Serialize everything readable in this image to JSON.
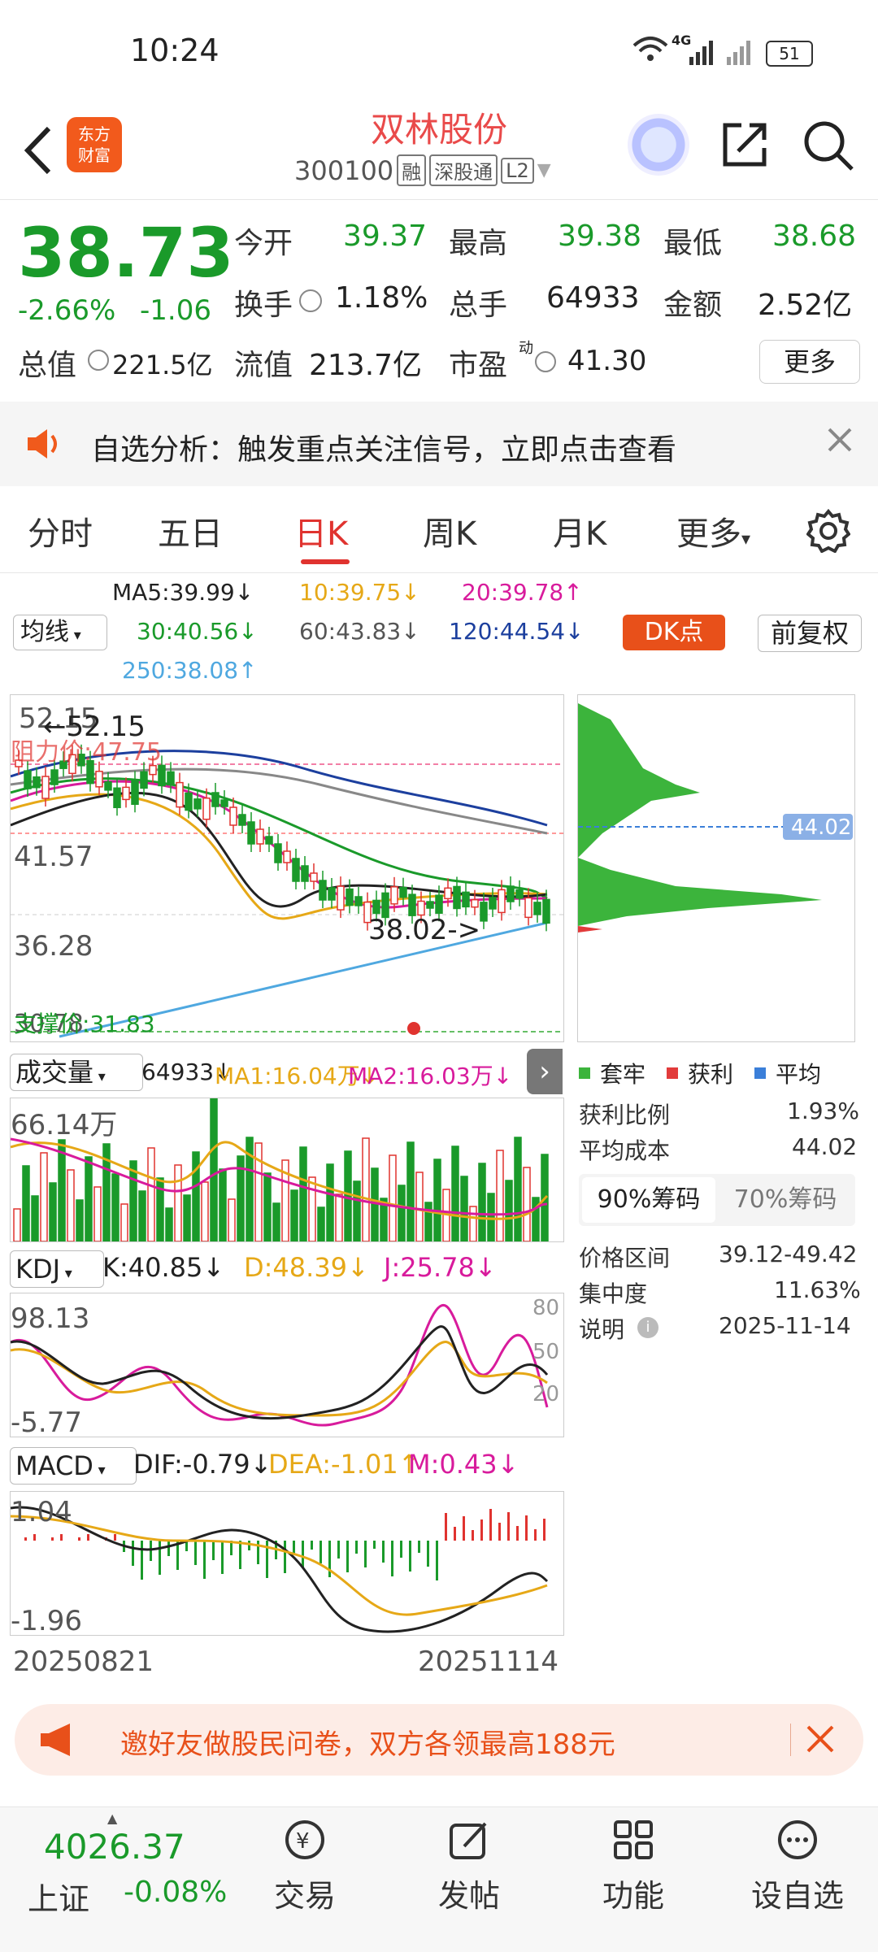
{
  "status": {
    "time": "10:24",
    "network": "4G",
    "battery": "51"
  },
  "header": {
    "logo_line1": "东方",
    "logo_line2": "财富",
    "stock_name": "双林股份",
    "stock_code": "300100",
    "tags": [
      "融",
      "深股通",
      "L2"
    ]
  },
  "quote": {
    "price": "38.73",
    "change_pct": "-2.66%",
    "change_val": "-1.06",
    "open_label": "今开",
    "open": "39.37",
    "high_label": "最高",
    "high": "39.38",
    "low_label": "最低",
    "low": "38.68",
    "turnover_label": "换手",
    "turnover": "1.18%",
    "volume_label": "总手",
    "volume": "64933",
    "amount_label": "金额",
    "amount": "2.52亿",
    "mcap_label": "总值",
    "mcap": "221.5亿",
    "float_label": "流值",
    "float": "213.7亿",
    "pe_label": "市盈",
    "pe_sup": "动",
    "pe": "41.30",
    "more_button": "更多"
  },
  "notice": {
    "text": "自选分析：触发重点关注信号，立即点击查看"
  },
  "tabs": [
    "分时",
    "五日",
    "日K",
    "周K",
    "月K",
    "更多"
  ],
  "active_tab": "日K",
  "ma": {
    "selector": "均线",
    "ma5": "MA5:39.99↓",
    "ma10": "10:39.75↓",
    "ma20": "20:39.78↑",
    "ma30": "30:40.56↓",
    "ma60": "60:43.83↓",
    "ma120": "120:44.54↓",
    "ma250": "250:38.08↑",
    "dk_button": "DK点",
    "adjust_button": "前复权"
  },
  "kchart": {
    "high_label": "52.15",
    "high_marker": "←52.15",
    "mid_label": "41.57",
    "low_label": "36.28",
    "bottom_label": "30.78",
    "resistance_label": "阻力价:47.75",
    "current_label": "38.02->",
    "support_label": "支撑价:31.83"
  },
  "chips": {
    "price_tag": "44.02",
    "legend": [
      "套牢",
      "获利",
      "平均"
    ],
    "legend_colors": [
      "#3cb43c",
      "#e23b3b",
      "#3b7fd9"
    ],
    "profit_ratio_label": "获利比例",
    "profit_ratio": "1.93%",
    "avg_cost_label": "平均成本",
    "avg_cost": "44.02",
    "tab_90": "90%筹码",
    "tab_70": "70%筹码",
    "range_label": "价格区间",
    "range": "39.12-49.42",
    "concentration_label": "集中度",
    "concentration": "11.63%",
    "note_label": "说明",
    "date": "2025-11-14"
  },
  "volume": {
    "selector": "成交量",
    "value": "64933↓",
    "ma1": "MA1:16.04万↓",
    "ma2": "MA2:16.03万↓",
    "top_label": "66.14万"
  },
  "kdj": {
    "selector": "KDJ",
    "k": "K:40.85↓",
    "d": "D:48.39↓",
    "j": "J:25.78↓",
    "top": "98.13",
    "bottom": "-5.77",
    "lv80": "80",
    "lv50": "50",
    "lv20": "20"
  },
  "macd": {
    "selector": "MACD",
    "dif": "DIF:-0.79↓",
    "dea": "DEA:-1.01↑",
    "m": "M:0.43↓",
    "top": "1.04",
    "bottom": "-1.96"
  },
  "dates": {
    "start": "20250821",
    "end": "20251114"
  },
  "promo": {
    "text": "邀好友做股民问卷，双方各领最高188元"
  },
  "bottom": {
    "index_value": "4026.37",
    "index_name": "上证",
    "index_change": "-0.08%",
    "nav": [
      "交易",
      "发帖",
      "功能",
      "设自选"
    ]
  }
}
